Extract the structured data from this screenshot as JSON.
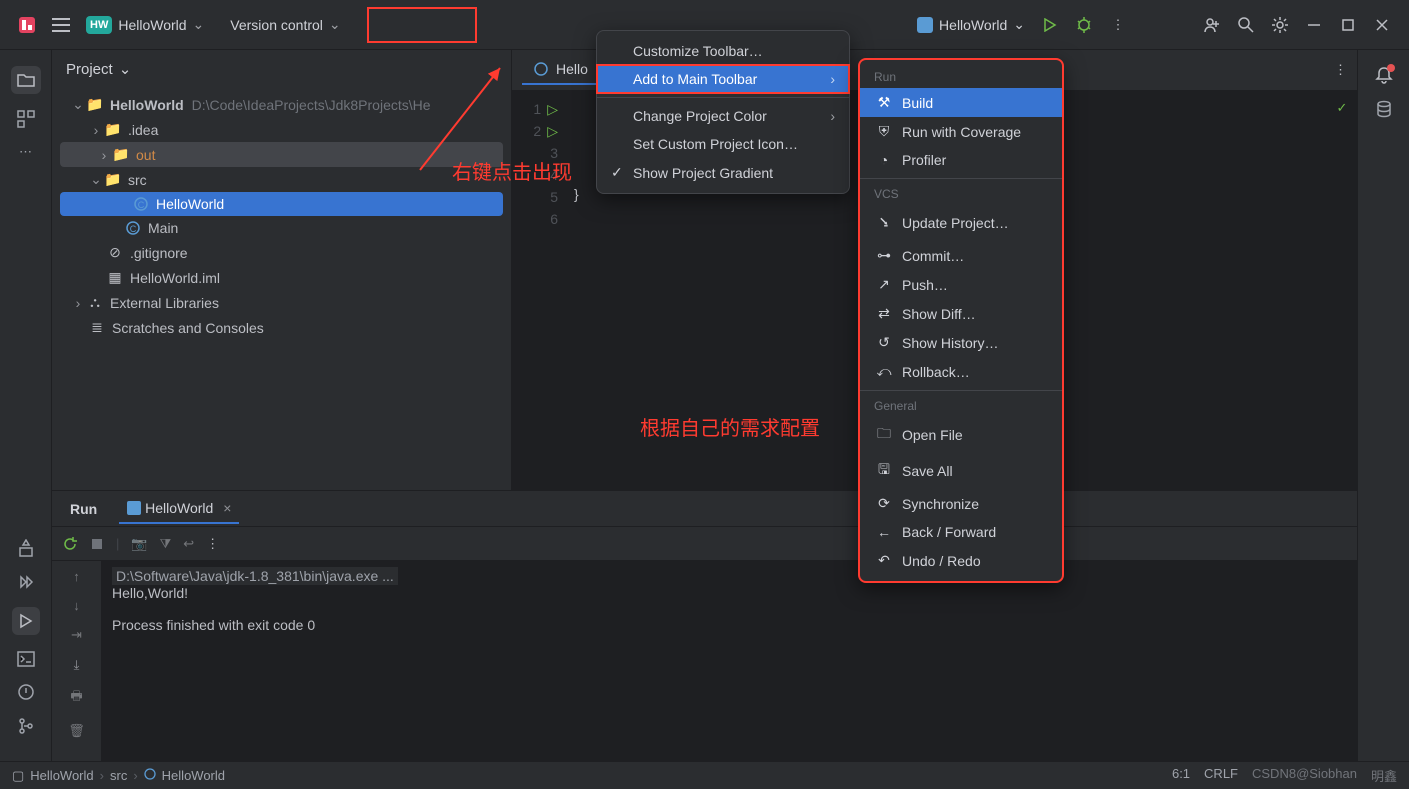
{
  "topbar": {
    "proj_badge": "HW",
    "proj_name": "HelloWorld",
    "vcs": "Version control",
    "run_target": "HelloWorld"
  },
  "project_panel": {
    "title": "Project",
    "root": "HelloWorld",
    "root_path": "D:\\Code\\IdeaProjects\\Jdk8Projects\\He",
    "nodes": {
      "idea": ".idea",
      "out": "out",
      "src": "src",
      "hello": "HelloWorld",
      "main": "Main",
      "gitignore": ".gitignore",
      "iml": "HelloWorld.iml",
      "ext": "External Libraries",
      "scratch": "Scratches and Consoles"
    }
  },
  "editor": {
    "tab": "Hello",
    "line5": "}",
    "lines": [
      "1",
      "2",
      "3",
      "4",
      "5",
      "6"
    ]
  },
  "run": {
    "tab_run": "Run",
    "tab_hw": "HelloWorld",
    "cmd": "D:\\Software\\Java\\jdk-1.8_381\\bin\\java.exe ...",
    "out1": "Hello,World!",
    "out2": "Process finished with exit code 0"
  },
  "status": {
    "c1": "HelloWorld",
    "c2": "src",
    "c3": "HelloWorld",
    "pos": "6:1",
    "eol": "CRLF",
    "wm1": "CSDN8@Siobhan",
    "wm2": "明鑫"
  },
  "ctx1": {
    "customize": "Customize Toolbar…",
    "add": "Add to Main Toolbar",
    "color": "Change Project Color",
    "icon": "Set Custom Project Icon…",
    "gradient": "Show Project Gradient"
  },
  "ctx2": {
    "h_run": "Run",
    "build": "Build",
    "coverage": "Run with Coverage",
    "profiler": "Profiler",
    "h_vcs": "VCS",
    "update": "Update Project…",
    "commit": "Commit…",
    "push": "Push…",
    "diff": "Show Diff…",
    "history": "Show History…",
    "rollback": "Rollback…",
    "h_gen": "General",
    "open": "Open File",
    "save": "Save All",
    "sync": "Synchronize",
    "back": "Back / Forward",
    "undo": "Undo / Redo"
  },
  "annotations": {
    "a1": "右键点击出现",
    "a2": "根据自己的需求配置"
  }
}
